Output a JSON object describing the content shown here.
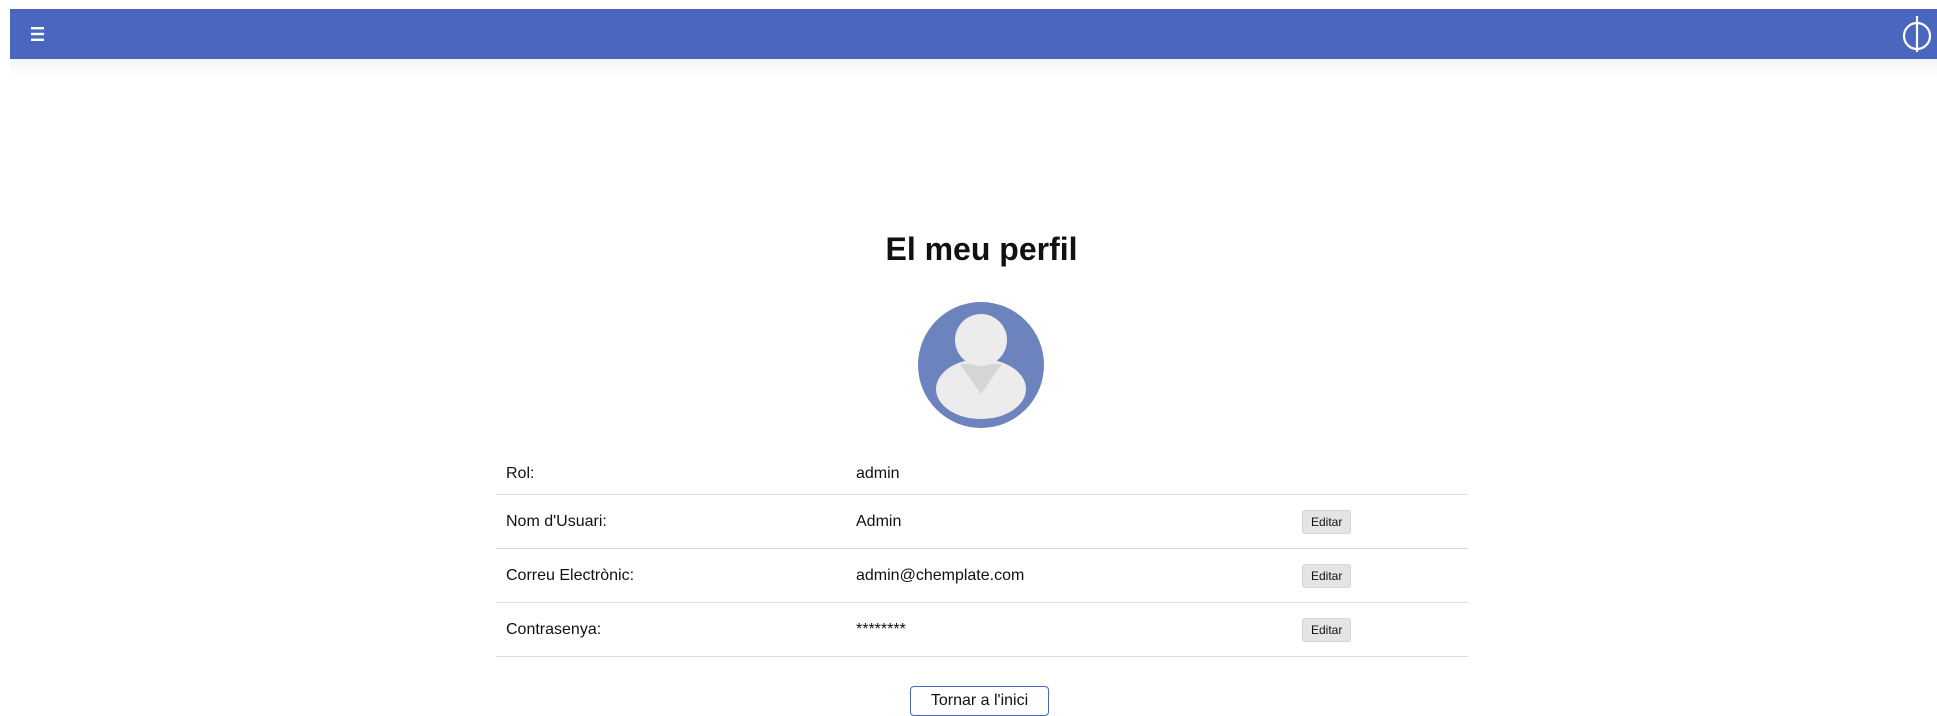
{
  "header": {
    "menu_icon": "hamburger-menu-icon",
    "logo_icon": "phi-logo-icon",
    "bar_color": "#4a66bf"
  },
  "page": {
    "title": "El meu perfil",
    "avatar_icon": "user-avatar-icon"
  },
  "profile": {
    "rows": [
      {
        "label": "Rol:",
        "value": "admin"
      },
      {
        "label": "Nom d'Usuari:",
        "value": "Admin",
        "action": "Editar"
      },
      {
        "label": "Correu Electrònic:",
        "value": "admin@chemplate.com",
        "action": "Editar"
      },
      {
        "label": "Contrasenya:",
        "value": "********",
        "action": "Editar"
      }
    ]
  },
  "footer": {
    "home_button": "Tornar a l'inici"
  }
}
